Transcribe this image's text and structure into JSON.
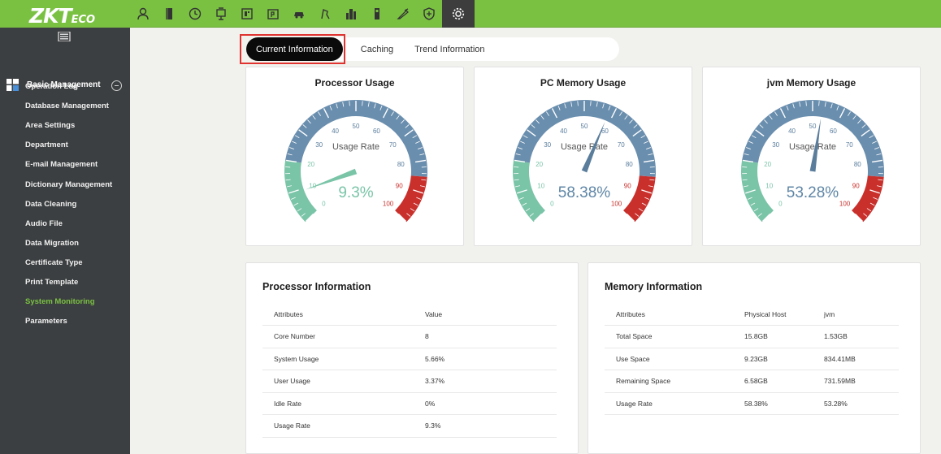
{
  "app": {
    "logo_main": "ZKT",
    "logo_tail": "eco"
  },
  "topbar": {
    "modules": [
      {
        "icon": "user-icon"
      },
      {
        "icon": "door-icon"
      },
      {
        "icon": "clock-icon"
      },
      {
        "icon": "elevator-icon"
      },
      {
        "icon": "visitor-icon"
      },
      {
        "icon": "parking-icon"
      },
      {
        "icon": "car-icon"
      },
      {
        "icon": "patrol-icon"
      },
      {
        "icon": "building-icon"
      },
      {
        "icon": "device-icon"
      },
      {
        "icon": "pen-icon"
      },
      {
        "icon": "shield-icon"
      },
      {
        "icon": "settings-gear-icon"
      }
    ]
  },
  "sidebar": {
    "group_label": "Basic Management",
    "items": [
      {
        "label": "Operation Log"
      },
      {
        "label": "Database Management"
      },
      {
        "label": "Area Settings"
      },
      {
        "label": "Department"
      },
      {
        "label": "E-mail Management"
      },
      {
        "label": "Dictionary Management"
      },
      {
        "label": "Data Cleaning"
      },
      {
        "label": "Audio File"
      },
      {
        "label": "Data Migration"
      },
      {
        "label": "Certificate Type"
      },
      {
        "label": "Print Template"
      },
      {
        "label": "System Monitoring"
      },
      {
        "label": "Parameters"
      }
    ],
    "active_index": 11
  },
  "tabs": [
    {
      "label": "Current Information"
    },
    {
      "label": "Caching"
    },
    {
      "label": "Trend Information"
    }
  ],
  "gauges": [
    {
      "title": "Processor Usage",
      "center_label": "Usage Rate",
      "value": 9.3,
      "value_text": "9.3%",
      "value_color": "#7ac4a8"
    },
    {
      "title": "PC Memory Usage",
      "center_label": "Usage Rate",
      "value": 58.38,
      "value_text": "58.38%",
      "value_color": "#5f86a6"
    },
    {
      "title": "jvm Memory Usage",
      "center_label": "Usage Rate",
      "value": 53.28,
      "value_text": "53.28%",
      "value_color": "#5f86a6"
    }
  ],
  "gauge_ticks": [
    "0",
    "10",
    "20",
    "30",
    "40",
    "50",
    "60",
    "70",
    "80",
    "90",
    "100"
  ],
  "colors": {
    "green_zone": "#7ac4a8",
    "blue_zone": "#6a8eae",
    "red_zone": "#c9302c",
    "brand": "#7ac142"
  },
  "processor_info": {
    "title": "Processor Information",
    "headers": [
      "Attributes",
      "Value"
    ],
    "rows": [
      [
        "Core Number",
        "8"
      ],
      [
        "System Usage",
        "5.66%"
      ],
      [
        "User Usage",
        "3.37%"
      ],
      [
        "Idle Rate",
        "0%"
      ],
      [
        "Usage Rate",
        "9.3%"
      ]
    ]
  },
  "memory_info": {
    "title": "Memory Information",
    "headers": [
      "Attributes",
      "Physical Host",
      "jvm"
    ],
    "rows": [
      [
        "Total Space",
        "15.8GB",
        "1.53GB"
      ],
      [
        "Use Space",
        "9.23GB",
        "834.41MB"
      ],
      [
        "Remaining Space",
        "6.58GB",
        "731.59MB"
      ],
      [
        "Usage Rate",
        "58.38%",
        "53.28%"
      ]
    ]
  }
}
